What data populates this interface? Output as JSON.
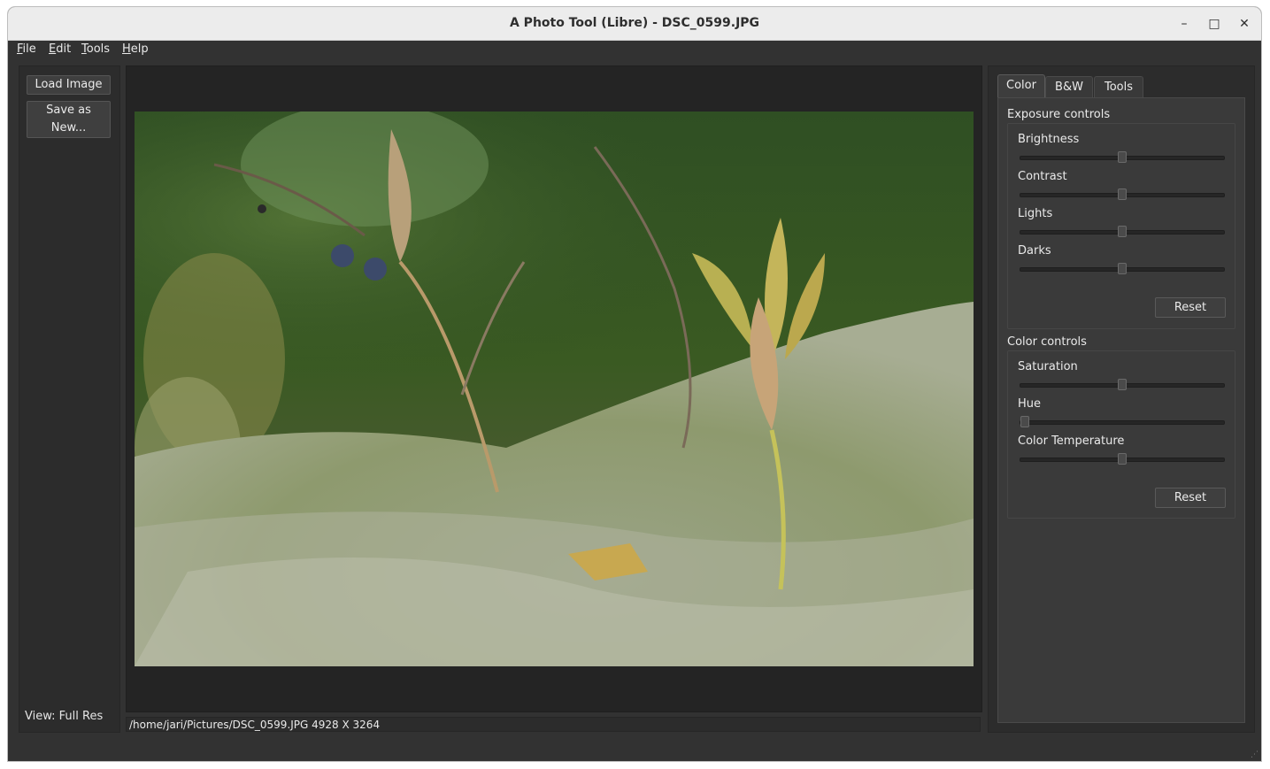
{
  "window": {
    "title": "A Photo Tool (Libre) - DSC_0599.JPG",
    "minimize": "–",
    "maximize": "□",
    "close": "✕"
  },
  "menu": [
    {
      "label": "File",
      "mnemonic": "F",
      "rest": "ile"
    },
    {
      "label": "Edit",
      "mnemonic": "E",
      "rest": "dit"
    },
    {
      "label": "Tools",
      "mnemonic": "T",
      "rest": "ools"
    },
    {
      "label": "Help",
      "mnemonic": "H",
      "rest": "elp"
    }
  ],
  "left_panel": {
    "load_button": "Load Image",
    "save_button": "Save as New...",
    "view_label": "View: Full Res"
  },
  "status_bar": {
    "text": "/home/jari/Pictures/DSC_0599.JPG 4928 X 3264"
  },
  "tabs": [
    {
      "label": "Color",
      "active": true
    },
    {
      "label": "B&W",
      "active": false
    },
    {
      "label": "Tools",
      "active": false
    }
  ],
  "exposure": {
    "title": "Exposure controls",
    "sliders": [
      {
        "label": "Brightness",
        "value": 0.5
      },
      {
        "label": "Contrast",
        "value": 0.5
      },
      {
        "label": "Lights",
        "value": 0.5
      },
      {
        "label": "Darks",
        "value": 0.5
      }
    ],
    "reset": "Reset"
  },
  "color": {
    "title": "Color controls",
    "sliders": [
      {
        "label": "Saturation",
        "value": 0.5
      },
      {
        "label": "Hue",
        "value": 0.0
      },
      {
        "label": "Color Temperature",
        "value": 0.5
      }
    ],
    "reset": "Reset"
  }
}
